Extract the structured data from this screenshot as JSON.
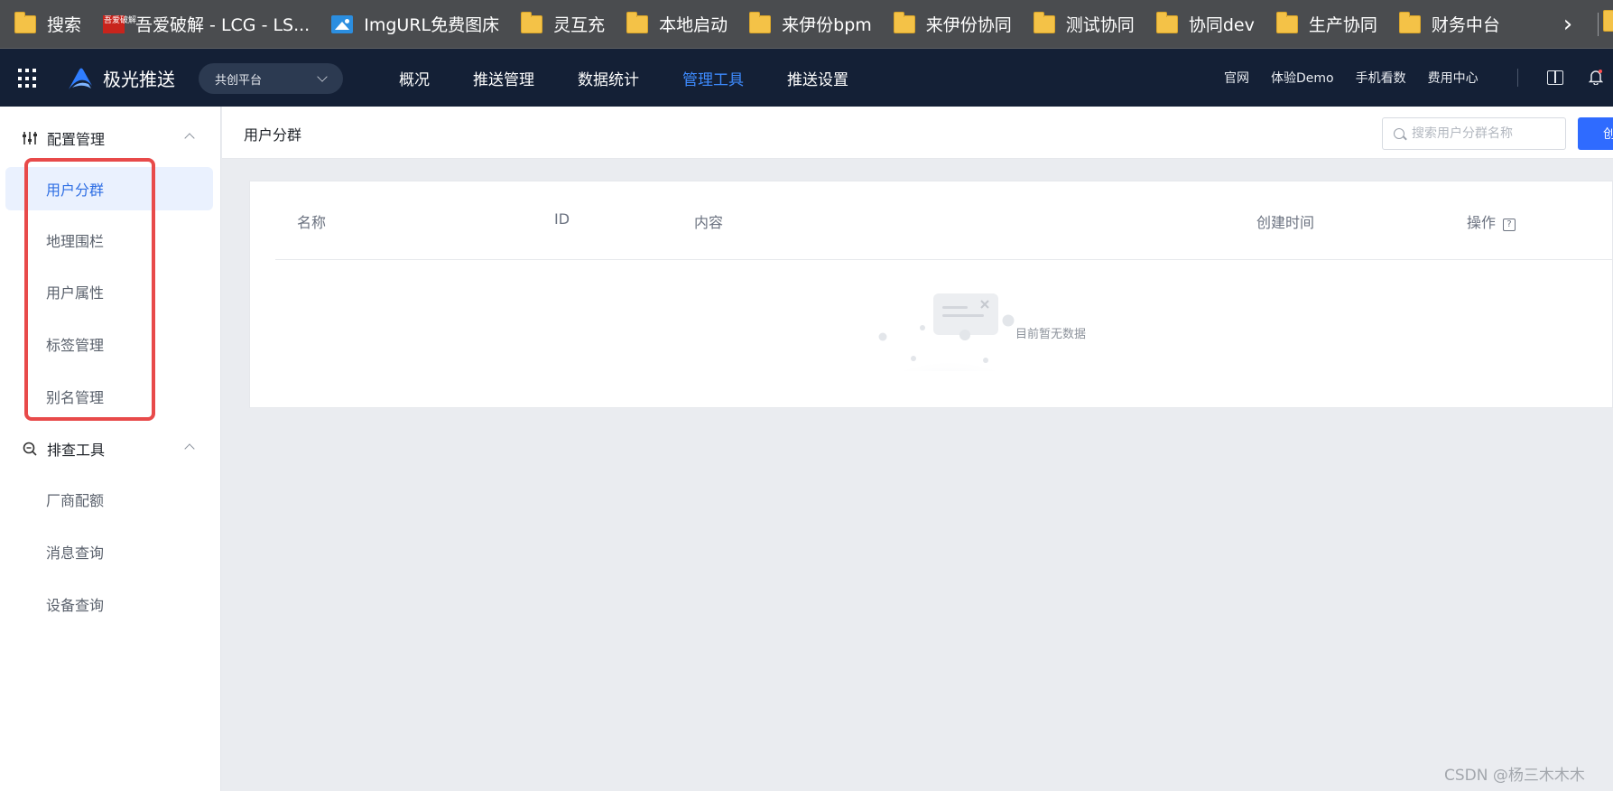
{
  "bookmarks": {
    "items": [
      {
        "label": "搜索",
        "icon": "folder-icon"
      },
      {
        "label": "吾爱破解 - LCG - LS...",
        "icon": "seal-icon",
        "icon_text": "吾爱破解"
      },
      {
        "label": "ImgURL免费图床",
        "icon": "image-icon"
      },
      {
        "label": "灵互充",
        "icon": "folder-icon"
      },
      {
        "label": "本地启动",
        "icon": "folder-icon"
      },
      {
        "label": "来伊份bpm",
        "icon": "folder-icon"
      },
      {
        "label": "来伊份协同",
        "icon": "folder-icon"
      },
      {
        "label": "测试协同",
        "icon": "folder-icon"
      },
      {
        "label": "协同dev",
        "icon": "folder-icon"
      },
      {
        "label": "生产协同",
        "icon": "folder-icon"
      },
      {
        "label": "财务中台",
        "icon": "folder-icon"
      }
    ],
    "more_glyph": "›"
  },
  "topnav": {
    "brand": "极光推送",
    "platform": "共创平台",
    "menu": [
      {
        "label": "概况",
        "active": false
      },
      {
        "label": "推送管理",
        "active": false
      },
      {
        "label": "数据统计",
        "active": false
      },
      {
        "label": "管理工具",
        "active": true
      },
      {
        "label": "推送设置",
        "active": false
      }
    ],
    "links": [
      "官网",
      "体验Demo",
      "手机看数",
      "费用中心"
    ],
    "colors": {
      "bg": "#142036",
      "active": "#3e8bff"
    }
  },
  "sidebar": {
    "groups": [
      {
        "title": "配置管理",
        "icon": "sliders-icon",
        "expanded": true,
        "items": [
          {
            "label": "用户分群",
            "active": true
          },
          {
            "label": "地理围栏",
            "active": false
          },
          {
            "label": "用户属性",
            "active": false
          },
          {
            "label": "标签管理",
            "active": false
          },
          {
            "label": "别名管理",
            "active": false
          }
        ]
      },
      {
        "title": "排查工具",
        "icon": "magnifier-icon",
        "expanded": true,
        "items": [
          {
            "label": "厂商配额",
            "active": false
          },
          {
            "label": "消息查询",
            "active": false
          },
          {
            "label": "设备查询",
            "active": false
          }
        ]
      }
    ],
    "highlight_color": "#e84a4a"
  },
  "content": {
    "title": "用户分群",
    "search_placeholder": "搜索用户分群名称",
    "create_label": "创",
    "table": {
      "columns": [
        "名称",
        "ID",
        "内容",
        "创建时间",
        "操作"
      ],
      "rows": [],
      "empty_text": "目前暂无数据"
    }
  },
  "watermark": "CSDN @杨三木木木"
}
